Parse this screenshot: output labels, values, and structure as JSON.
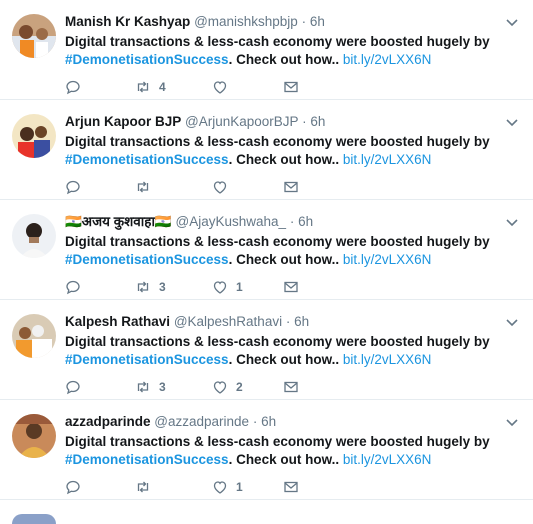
{
  "tweets": [
    {
      "name": "Manish Kr Kashyap",
      "handle": "@manishkshpbjp",
      "separator": "·",
      "time": "6h",
      "text_main": "Digital transactions & less-cash economy were boosted hugely by",
      "hashtag": "#DemonetisationSuccess",
      "text_tail": ". Check out how..",
      "link": "bit.ly/2vLXX6N",
      "replies": "",
      "retweets": "4",
      "likes": ""
    },
    {
      "name": "Arjun Kapoor BJP",
      "handle": "@ArjunKapoorBJP",
      "separator": "·",
      "time": "6h",
      "text_main": "Digital transactions & less-cash economy were boosted hugely by",
      "hashtag": "#DemonetisationSuccess",
      "text_tail": ". Check out how..",
      "link": "bit.ly/2vLXX6N",
      "replies": "",
      "retweets": "",
      "likes": ""
    },
    {
      "name": "🇮🇳अजय कुशवाहा🇮🇳",
      "handle": "@AjayKushwaha_",
      "separator": "·",
      "time": "6h",
      "text_main": "Digital transactions & less-cash economy were boosted hugely by",
      "hashtag": "#DemonetisationSuccess",
      "text_tail": ". Check out how..",
      "link": "bit.ly/2vLXX6N",
      "replies": "",
      "retweets": "3",
      "likes": "1"
    },
    {
      "name": "Kalpesh Rathavi",
      "handle": "@KalpeshRathavi",
      "separator": "·",
      "time": "6h",
      "text_main": "Digital transactions & less-cash economy were boosted hugely by",
      "hashtag": "#DemonetisationSuccess",
      "text_tail": ". Check out how..",
      "link": "bit.ly/2vLXX6N",
      "replies": "",
      "retweets": "3",
      "likes": "2"
    },
    {
      "name": "azzadparinde",
      "handle": "@azzadparinde",
      "separator": "·",
      "time": "6h",
      "text_main": "Digital transactions & less-cash economy were boosted hugely by",
      "hashtag": "#DemonetisationSuccess",
      "text_tail": ". Check out how..",
      "link": "bit.ly/2vLXX6N",
      "replies": "",
      "retweets": "",
      "likes": "1"
    }
  ],
  "colors": {
    "name": "#14171a",
    "muted": "#657786",
    "link": "#1b95e0",
    "divider": "#e6ecf0"
  },
  "icons": {
    "reply": "reply-icon",
    "retweet": "retweet-icon",
    "like": "heart-icon",
    "message": "envelope-icon",
    "menu": "chevron-down-icon"
  }
}
